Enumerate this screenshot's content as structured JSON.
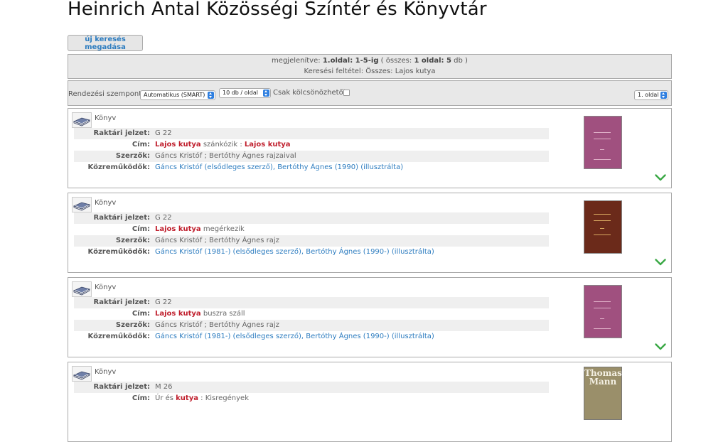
{
  "page": {
    "title": "Heinrich Antal Közösségi Színtér és Könyvtár"
  },
  "new_search_label": "új keresés megadása",
  "info": {
    "shown_prefix": "megjelenítve: ",
    "shown_range": "1.oldal: 1-5-ig",
    "shown_mid": " ( összes: ",
    "shown_total": "1 oldal: 5",
    "shown_suffix": " db )",
    "criteria": "Keresési feltétel: Összes: Lajos kutya"
  },
  "sort": {
    "label": "Rendezési szempont:",
    "order_value": "Automatikus (SMART)",
    "per_page_value": "10 db / oldal",
    "loanable_label": "Csak kölcsönözhetők",
    "page_value": "1. oldal"
  },
  "labels": {
    "call_number": "Raktári jelzet:",
    "title": "Cím:",
    "authors": "Szerzők:",
    "contributors": "Közreműködők:"
  },
  "records": [
    {
      "type": "Könyv",
      "call_number": "G 22",
      "title_hl": "Lajos kutya",
      "title_rest": " szánkózik : ",
      "title_hl2": "Lajos kutya",
      "authors": "Gáncs Kristóf ; Bertóthy Ágnes rajzaival",
      "contributor_1": "Gáncs Kristóf (elsődleges szerző)",
      "contributor_sep": ", ",
      "contributor_2": "Bertóthy Ágnes (1990) (illusztrálta)",
      "cover_color": "#a0507f"
    },
    {
      "type": "Könyv",
      "call_number": "G 22",
      "title_hl": "Lajos kutya",
      "title_rest": " megérkezik",
      "title_hl2": "",
      "authors": "Gáncs Kristóf ; Bertóthy Ágnes rajz",
      "contributor_1": "Gáncs Kristóf (1981-) (elsődleges szerző)",
      "contributor_sep": ", ",
      "contributor_2": "Bertóthy Ágnes (1990-) (illusztrálta)",
      "cover_color": "#6b2a1a"
    },
    {
      "type": "Könyv",
      "call_number": "G 22",
      "title_hl": "Lajos kutya",
      "title_rest": " buszra száll",
      "title_hl2": "",
      "authors": "Gáncs Kristóf ; Bertóthy Ágnes rajz",
      "contributor_1": "Gáncs Kristóf (1981-) (elsődleges szerző)",
      "contributor_sep": ", ",
      "contributor_2": "Bertóthy Ágnes (1990-) (illusztrálta)",
      "cover_color": "#a0507f"
    },
    {
      "type": "Könyv",
      "call_number": "M 26",
      "title_pre": "Úr és ",
      "title_hl": "kutya",
      "title_rest": " : Kisregények",
      "cover_text_1": "Thomas",
      "cover_text_2": "Mann",
      "cover_color": "#9a8f6a"
    }
  ],
  "colors": {
    "highlight": "#c0202e",
    "link": "#2e7dc0",
    "expand_chevron": "#3aa845"
  }
}
